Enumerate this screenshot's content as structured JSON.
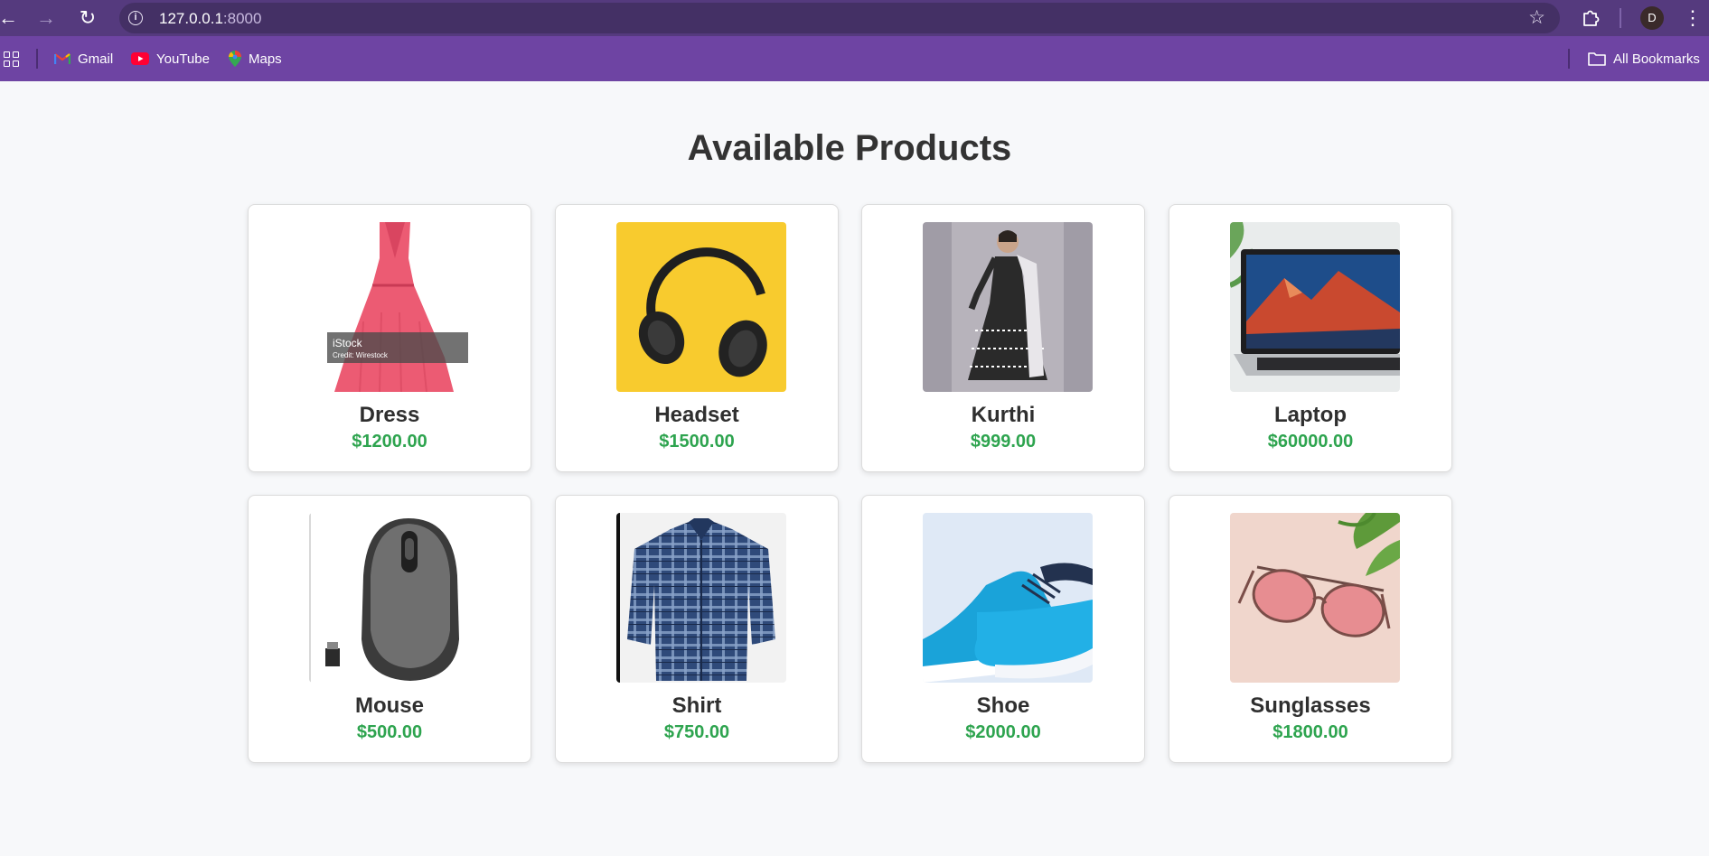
{
  "browser": {
    "url_host": "127.0.0.1",
    "url_port": ":8000",
    "profile_initial": "D",
    "bookmarks": [
      {
        "label": "Gmail",
        "icon": "gmail-icon"
      },
      {
        "label": "YouTube",
        "icon": "youtube-icon"
      },
      {
        "label": "Maps",
        "icon": "maps-icon"
      }
    ],
    "all_bookmarks_label": "All Bookmarks"
  },
  "page": {
    "title": "Available Products"
  },
  "products": [
    {
      "name": "Dress",
      "price": "$1200.00",
      "image": "dress-image"
    },
    {
      "name": "Headset",
      "price": "$1500.00",
      "image": "headset-image"
    },
    {
      "name": "Kurthi",
      "price": "$999.00",
      "image": "kurthi-image"
    },
    {
      "name": "Laptop",
      "price": "$60000.00",
      "image": "laptop-image"
    },
    {
      "name": "Mouse",
      "price": "$500.00",
      "image": "mouse-image"
    },
    {
      "name": "Shirt",
      "price": "$750.00",
      "image": "shirt-image"
    },
    {
      "name": "Shoe",
      "price": "$2000.00",
      "image": "shoe-image"
    },
    {
      "name": "Sunglasses",
      "price": "$1800.00",
      "image": "sunglasses-image"
    }
  ],
  "image_text": {
    "dress_watermark": "iStock",
    "dress_watermark_credit": "Credit: Wirestock"
  },
  "colors": {
    "toolbar": "#553a7e",
    "bookmarks_bar": "#6e44a3",
    "price": "#2ea44f",
    "title": "#333333",
    "page_bg": "#f7f8fa"
  }
}
